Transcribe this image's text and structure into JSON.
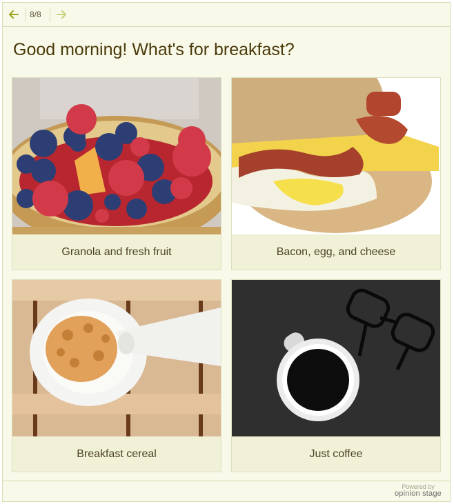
{
  "nav": {
    "counter": "8/8",
    "prev_icon": "arrow-left-icon",
    "next_icon": "arrow-right-icon",
    "accent": "#9aa31e"
  },
  "question": {
    "title": "Good morning! What's for breakfast?"
  },
  "options": [
    {
      "label": "Granola and fresh fruit",
      "image": "bowl-of-berries-photo"
    },
    {
      "label": "Bacon, egg, and cheese",
      "image": "breakfast-sandwich-photo"
    },
    {
      "label": "Breakfast cereal",
      "image": "cereal-bowl-with-milk-photo"
    },
    {
      "label": "Just coffee",
      "image": "black-coffee-and-glasses-photo"
    }
  ],
  "footer": {
    "powered_by": "Powered by",
    "brand": "opinion stage"
  },
  "colors": {
    "background": "#f8f9e8",
    "border": "#d9dcb6",
    "title_text": "#4a3a0a",
    "label_bg": "#f0f1d7"
  }
}
